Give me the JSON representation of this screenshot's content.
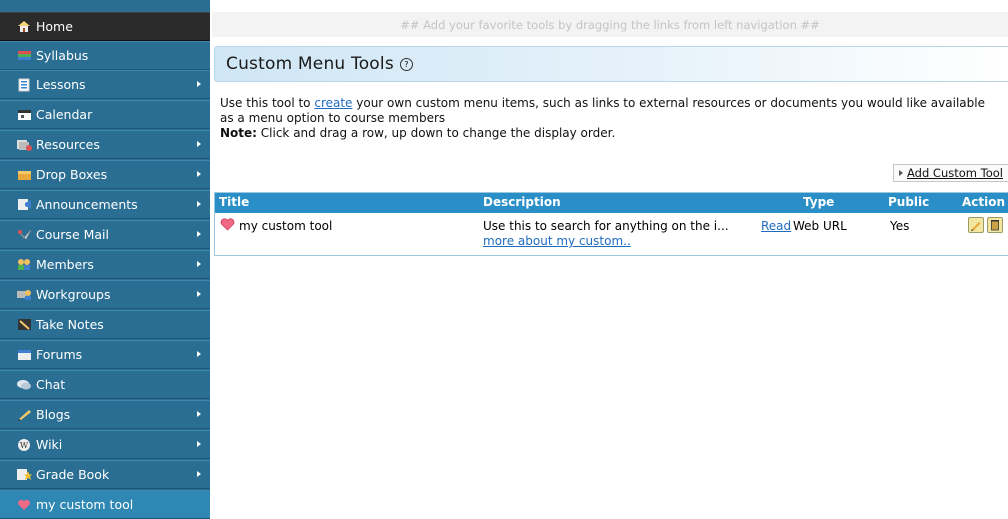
{
  "nav": {
    "items": [
      {
        "label": "Home",
        "icon": "home-icon"
      },
      {
        "label": "Syllabus",
        "icon": "books-icon"
      },
      {
        "label": "Lessons",
        "icon": "document-icon"
      },
      {
        "label": "Calendar",
        "icon": "calendar-icon"
      },
      {
        "label": "Resources",
        "icon": "resources-icon"
      },
      {
        "label": "Drop Boxes",
        "icon": "dropbox-icon"
      },
      {
        "label": "Announcements",
        "icon": "announcement-icon"
      },
      {
        "label": "Course Mail",
        "icon": "mail-icon"
      },
      {
        "label": "Members",
        "icon": "members-icon"
      },
      {
        "label": "Workgroups",
        "icon": "workgroups-icon"
      },
      {
        "label": "Take Notes",
        "icon": "notes-icon"
      },
      {
        "label": "Forums",
        "icon": "forums-icon"
      },
      {
        "label": "Chat",
        "icon": "chat-icon"
      },
      {
        "label": "Blogs",
        "icon": "blogs-icon"
      },
      {
        "label": "Wiki",
        "icon": "wiki-icon"
      },
      {
        "label": "Grade Book",
        "icon": "gradebook-icon"
      },
      {
        "label": "my custom tool",
        "icon": "heart-icon"
      }
    ]
  },
  "topbar": {
    "hint": "## Add your favorite tools by dragging the links from left navigation ##"
  },
  "page": {
    "title": "Custom Menu Tools",
    "desc_pre": "Use this tool to ",
    "desc_link": "create",
    "desc_post": " your own custom menu items, such as links to external resources or documents you would like available as a menu option to course members",
    "note_label": "Note:",
    "note_text": " Click and drag a row, up down to change the display order.",
    "add_button": "Add Custom Tool"
  },
  "table": {
    "headers": {
      "title": "Title",
      "description": "Description",
      "type": "Type",
      "public": "Public",
      "action": "Action"
    },
    "rows": [
      {
        "title": "my custom tool",
        "description": "Use this to search for anything on the i...",
        "read_link": "Read",
        "more_link": "more about my custom..",
        "type": "Web URL",
        "public": "Yes"
      }
    ]
  },
  "colors": {
    "sidebar": "#2a6e93",
    "home": "#2b2b2b",
    "active": "#2f87b3",
    "table_header": "#2a8fc6",
    "link": "#1f6cc0"
  }
}
